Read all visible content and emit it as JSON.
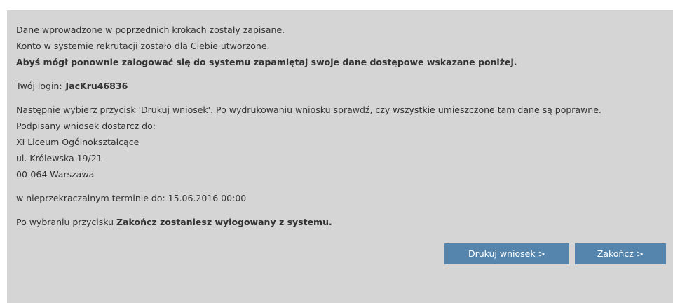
{
  "message": {
    "saved": "Dane wprowadzone w poprzednich krokach zostały zapisane.",
    "account_created": "Konto w systemie rekrutacji zostało dla Ciebie utworzone.",
    "remember": "Abyś mógł ponownie zalogować się do systemu zapamiętaj swoje dane dostępowe wskazane poniżej."
  },
  "login": {
    "label": "Twój login:",
    "value": "JacKru46836"
  },
  "instructions": {
    "print_check": "Następnie wybierz przycisk 'Drukuj wniosek'. Po wydrukowaniu wniosku sprawdź, czy wszystkie umieszczone tam dane są poprawne.",
    "deliver_to": "Podpisany wniosek dostarcz do:",
    "school_name": "XI Liceum Ogólnokształcące",
    "school_street": "ul. Królewska 19/21",
    "school_city": "00-064 Warszawa"
  },
  "deadline": {
    "text": "w nieprzekraczalnym terminie do: 15.06.2016 00:00"
  },
  "logout_note": {
    "prefix": "Po wybraniu przycisku",
    "bold": "Zakończ zostaniesz wylogowany z systemu."
  },
  "buttons": {
    "print_label": "Drukuj wniosek >",
    "finish_label": "Zakończ >"
  },
  "colors": {
    "panel_bg": "#d5d5d5",
    "button_bg": "#5585ad",
    "button_text": "#ffffff",
    "text": "#333333"
  }
}
